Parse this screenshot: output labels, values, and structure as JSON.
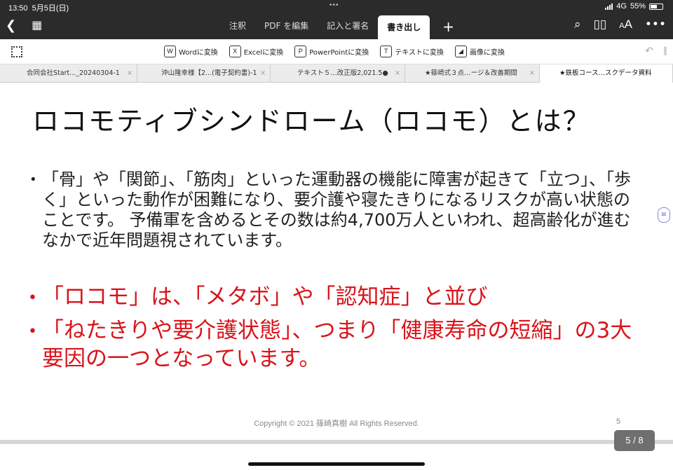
{
  "status": {
    "time": "13:50",
    "date": "5月5日(日)",
    "network": "4G",
    "battery": "55%"
  },
  "toolbar": {
    "tabs": [
      "注釈",
      "PDF を編集",
      "記入と署名",
      "書き出し"
    ],
    "active_tab": "書き出し",
    "icons": [
      "back-icon",
      "grid-icon",
      "plus-icon",
      "search-icon",
      "book-icon",
      "text-size-icon",
      "more-icon"
    ]
  },
  "export_bar": {
    "items": [
      {
        "icon": "W",
        "label": "Wordに変換"
      },
      {
        "icon": "X",
        "label": "Excelに変換"
      },
      {
        "icon": "P",
        "label": "PowerPointに変換"
      },
      {
        "icon": "T",
        "label": "テキストに変換"
      },
      {
        "icon": "img",
        "label": "画像に変換"
      }
    ]
  },
  "doc_tabs": [
    {
      "label": "合同会社Start..._20240304-1"
    },
    {
      "label": "沖山隆幸様【2...(電子契約書)-1"
    },
    {
      "label": "テキスト５…改正版2,021.5●"
    },
    {
      "label": "★篠崎式３点…ージ＆改善期間"
    },
    {
      "label": "★鉄板コース…スクデータ資料"
    }
  ],
  "slide": {
    "title": "ロコモティブシンドローム（ロコモ）とは？",
    "bullet1": "「骨」や「関節」、「筋肉」といった運動器の機能に障害が起きて「立つ」、「歩く」といった動作が困難になり、要介護や寝たきりになるリスクが高い状態のことです。 予備軍を含めるとその数は約4,700万人といわれ、超高齢化が進むなかで近年問題視されています。",
    "bullet2": "「ロコモ」は、「メタボ」や「認知症」と並び",
    "bullet3": "「ねたきりや要介護状態」、つまり「健康寿命の短縮」の3大要因の一つとなっています。",
    "copyright": "Copyright © 2021 篠崎真樹 All Rights Reserved.",
    "page_number": "5"
  },
  "page_indicator": "5 / 8",
  "colors": {
    "toolbar_bg": "#2b2b2b",
    "accent_red": "#d9131a"
  }
}
